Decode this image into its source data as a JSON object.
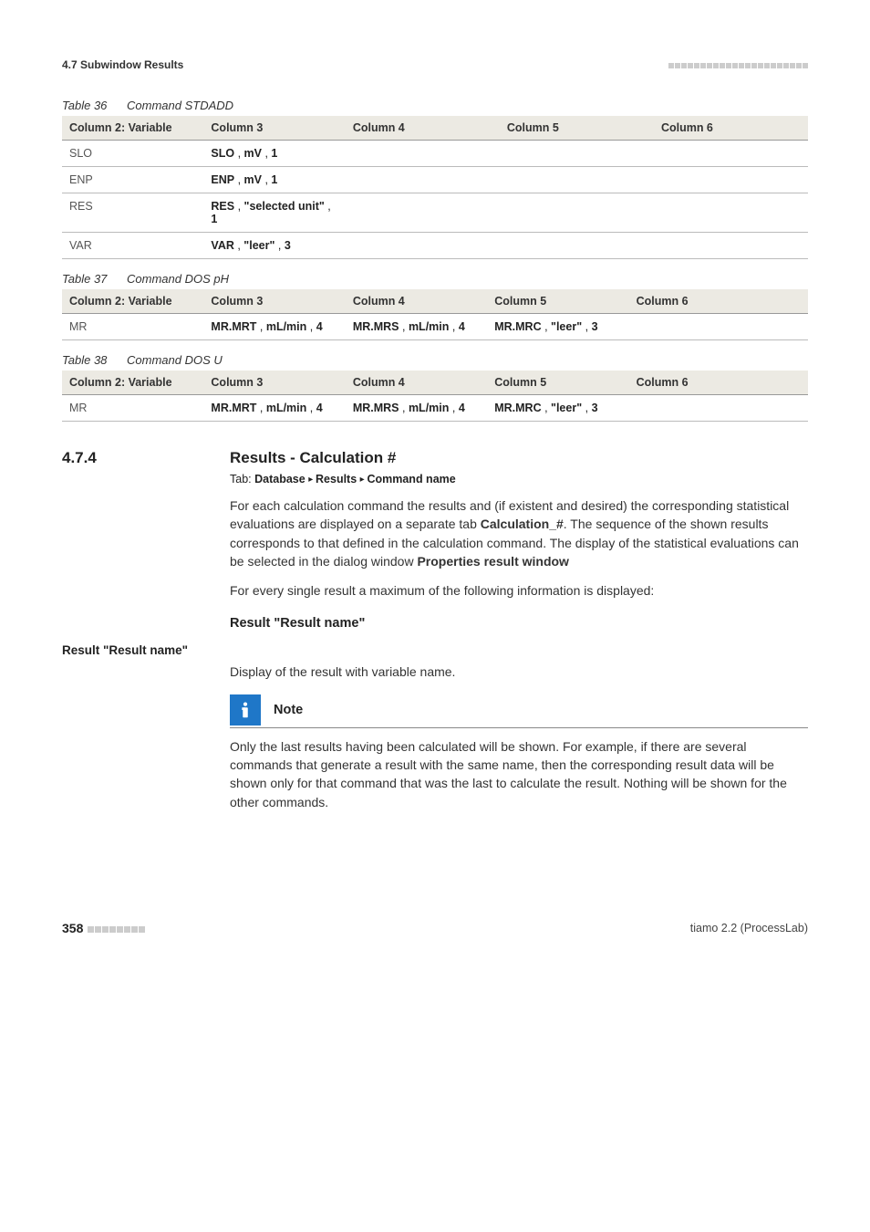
{
  "header": {
    "section_label": "4.7 Subwindow Results"
  },
  "tables": {
    "t36": {
      "caption_num": "Table 36",
      "caption_title": "Command STDADD",
      "headers": [
        "Column 2: Variable",
        "Column 3",
        "Column 4",
        "Column 5",
        "Column 6"
      ],
      "rows": [
        {
          "c1": "SLO",
          "c3": {
            "bold1": "SLO",
            "sep1": " , ",
            "bold2": "mV",
            "sep2": " , ",
            "bold3": "1"
          }
        },
        {
          "c1": "ENP",
          "c3": {
            "bold1": "ENP",
            "sep1": " , ",
            "bold2": "mV",
            "sep2": " , ",
            "bold3": "1"
          }
        },
        {
          "c1": "RES",
          "c3": {
            "bold1": "RES",
            "sep1": " , ",
            "bold2": "\"selected unit\"",
            "sep2": " , ",
            "bold3": "1"
          }
        },
        {
          "c1": "VAR",
          "c3": {
            "bold1": "VAR",
            "sep1": " , ",
            "bold2": "\"leer\"",
            "sep2": " , ",
            "bold3": "3"
          }
        }
      ]
    },
    "t37": {
      "caption_num": "Table 37",
      "caption_title": "Command DOS pH",
      "headers": [
        "Column 2: Variable",
        "Column 3",
        "Column 4",
        "Column 5",
        "Column 6"
      ],
      "rows": [
        {
          "c1": "MR",
          "c3": {
            "bold1": "MR.MRT",
            "sep1": " , ",
            "bold2": "mL/min",
            "sep2": " , ",
            "bold3": "4"
          },
          "c4": {
            "bold1": "MR.MRS",
            "sep1": " , ",
            "bold2": "mL/min",
            "sep2": " , ",
            "bold3": "4"
          },
          "c5": {
            "bold1": "MR.MRC",
            "sep1": " , ",
            "bold2": "\"leer\"",
            "sep2": " , ",
            "bold3": "3"
          }
        }
      ]
    },
    "t38": {
      "caption_num": "Table 38",
      "caption_title": "Command DOS U",
      "headers": [
        "Column 2: Variable",
        "Column 3",
        "Column 4",
        "Column 5",
        "Column 6"
      ],
      "rows": [
        {
          "c1": "MR",
          "c3": {
            "bold1": "MR.MRT",
            "sep1": " , ",
            "bold2": "mL/min",
            "sep2": " , ",
            "bold3": "4"
          },
          "c4": {
            "bold1": "MR.MRS",
            "sep1": " , ",
            "bold2": "mL/min",
            "sep2": " , ",
            "bold3": "4"
          },
          "c5": {
            "bold1": "MR.MRC",
            "sep1": " , ",
            "bold2": "\"leer\"",
            "sep2": " , ",
            "bold3": "3"
          }
        }
      ]
    }
  },
  "section": {
    "number": "4.7.4",
    "title": "Results - Calculation #",
    "tab_label": "Tab:",
    "tab_path": [
      "Database",
      "Results",
      "Command name"
    ],
    "para1_a": "For each calculation command the results and (if existent and desired) the corresponding statistical evaluations are displayed on a separate tab ",
    "para1_bold1": "Calculation_#",
    "para1_b": ". The sequence of the shown results corresponds to that defined in the calculation command. The display of the statistical evaluations can be selected in the dialog window ",
    "para1_bold2": "Properties result window",
    "para2": "For every single result a maximum of the following information is displayed:",
    "subhead": "Result \"Result name\"",
    "field_label": "Result \"Result name\"",
    "field_desc": "Display of the result with variable name.",
    "note_title": "Note",
    "note_body": "Only the last results having been calculated will be shown. For example, if there are several commands that generate a result with the same name, then the corresponding result data will be shown only for that command that was the last to calculate the result. Nothing will be shown for the other commands."
  },
  "footer": {
    "page_num": "358",
    "product": "tiamo 2.2 (ProcessLab)"
  }
}
